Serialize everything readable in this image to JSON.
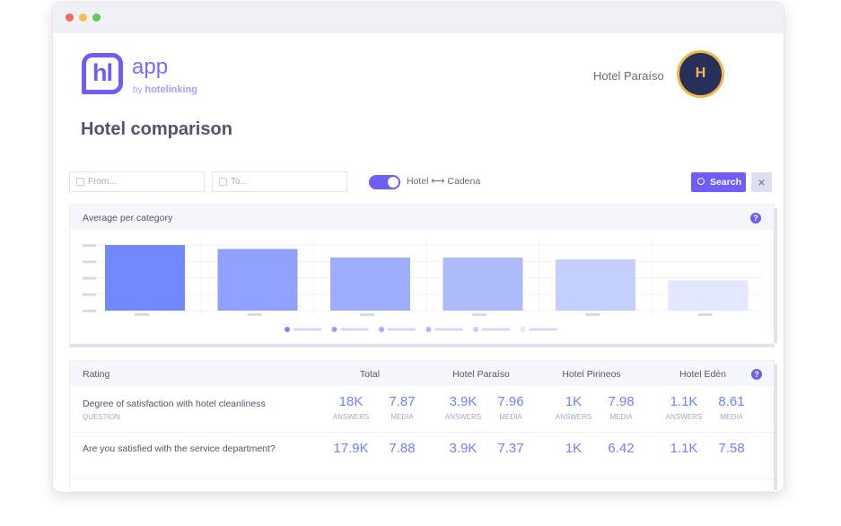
{
  "brand": {
    "logo_text": "hl",
    "app": "app",
    "by": "by",
    "company": "hotelinking"
  },
  "page_title": "Hotel comparison",
  "hotel": {
    "name": "Hotel Paraíso",
    "logo_letter": "H"
  },
  "filters": {
    "from_placeholder": "From...",
    "to_placeholder": "To...",
    "toggle_label": "Hotel ⟷ Cadena",
    "toggle_on": true,
    "search_label": "Search",
    "clear_icon": "×"
  },
  "chart_panel": {
    "title": "Average per category",
    "help": "?"
  },
  "chart_data": {
    "type": "bar",
    "title": "Average per category",
    "categories": [
      "",
      "",
      "",
      "",
      "",
      ""
    ],
    "values": [
      100,
      94,
      81,
      81,
      78,
      46
    ],
    "ylim": [
      0,
      100
    ],
    "colors": [
      "#7289fd",
      "#8fa1fd",
      "#9eaefc",
      "#adbafc",
      "#c5cffd",
      "#e2e7fe"
    ],
    "grid": true,
    "legend": "bottom"
  },
  "table": {
    "headers": {
      "rating": "Rating",
      "groups": [
        "Total",
        "Hotel Paraíso",
        "Hotel Pirineos",
        "Hotel Edén"
      ],
      "help": "?"
    },
    "answers_label": "ANSWERS",
    "media_label": "MEDIA",
    "rows": [
      {
        "question": "Degree of satisfaction with hotel cleanliness",
        "type": "QUESTION",
        "values": [
          [
            "18K",
            "7.87"
          ],
          [
            "3.9K",
            "7.96"
          ],
          [
            "1K",
            "7.98"
          ],
          [
            "1.1K",
            "8.61"
          ]
        ]
      },
      {
        "question": "Are you satisfied with the service department?",
        "values": [
          [
            "17.9K",
            "7.88"
          ],
          [
            "3.9K",
            "7.37"
          ],
          [
            "1K",
            "6.42"
          ],
          [
            "1.1K",
            "7.58"
          ]
        ]
      }
    ]
  }
}
